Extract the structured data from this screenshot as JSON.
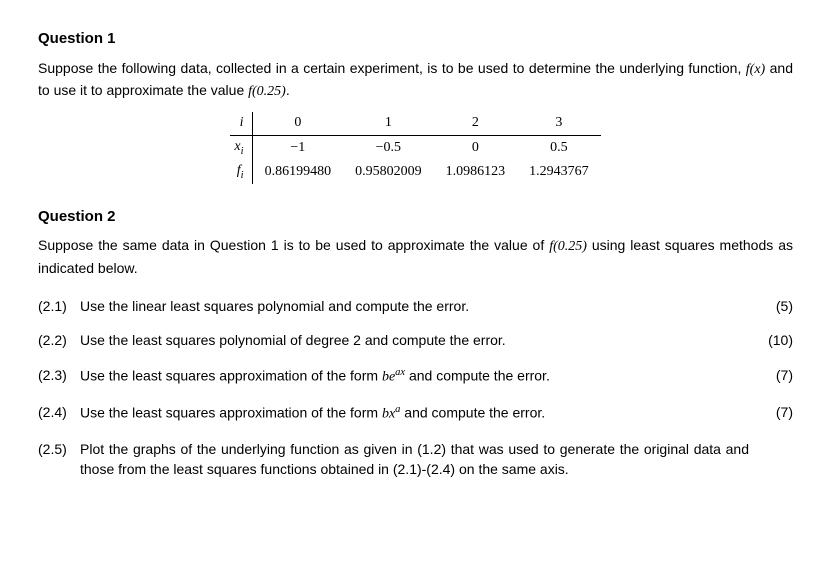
{
  "q1": {
    "title": "Question 1",
    "para_a": "Suppose the following data, collected in a certain experiment, is to be used to determine the underlying function, ",
    "para_b": " and to use it to approximate the value ",
    "fx": "f(x)",
    "f025": "f(0.25)",
    "period": ".",
    "table": {
      "row_i_label": "i",
      "row_x_label": "x",
      "row_x_sub": "i",
      "row_f_label": "f",
      "row_f_sub": "i",
      "i": [
        "0",
        "1",
        "2",
        "3"
      ],
      "x": [
        "−1",
        "−0.5",
        "0",
        "0.5"
      ],
      "f": [
        "0.86199480",
        "0.95802009",
        "1.0986123",
        "1.2943767"
      ]
    }
  },
  "q2": {
    "title": "Question 2",
    "para_a": "Suppose the same data in Question 1 is to be used to approximate the value of ",
    "f025": "f(0.25)",
    "para_b": " using least squares methods as indicated below.",
    "items": {
      "i1": {
        "num": "(2.1)",
        "text": "Use the linear least squares polynomial and compute the error.",
        "pts": "(5)"
      },
      "i2": {
        "num": "(2.2)",
        "text": "Use the least squares polynomial of degree 2 and compute the error.",
        "pts": "(10)"
      },
      "i3": {
        "num": "(2.3)",
        "pre": "Use the least squares approximation of the form ",
        "form_b": "be",
        "form_exp": "ax",
        "post": " and compute the error.",
        "pts": "(7)"
      },
      "i4": {
        "num": "(2.4)",
        "pre": "Use the least squares approximation of the form ",
        "form_b": "bx",
        "form_exp": "a",
        "post": " and compute the error.",
        "pts": "(7)"
      },
      "i5": {
        "num": "(2.5)",
        "text": "Plot the graphs of the underlying function as given in (1.2) that was used to generate the original data and those from the least squares functions obtained in (2.1)-(2.4) on the same axis."
      }
    }
  }
}
